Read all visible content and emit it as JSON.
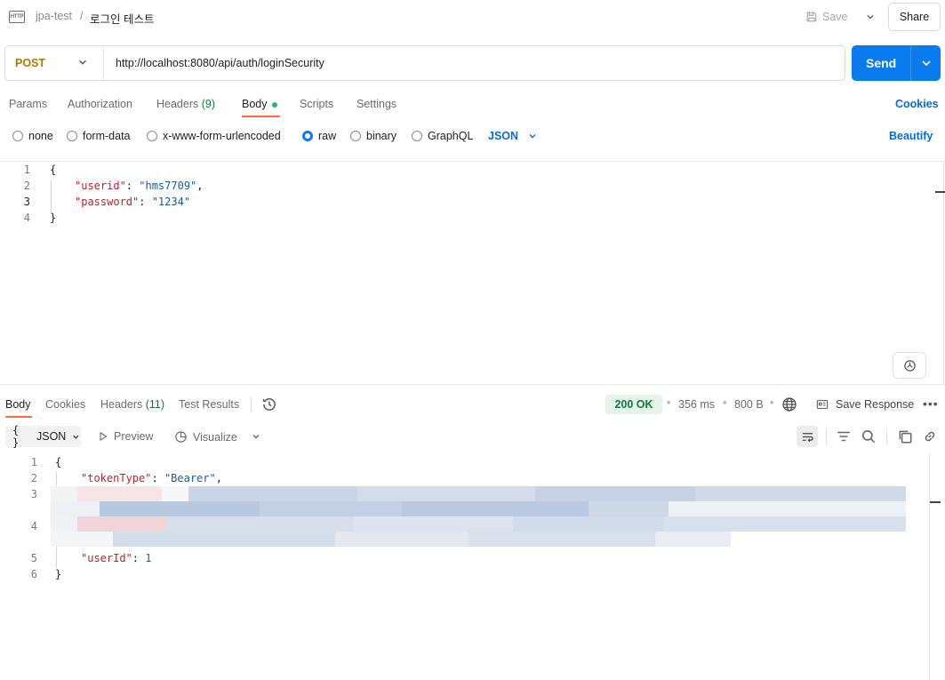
{
  "header": {
    "collection": "jpa-test",
    "separator": "/",
    "request_name": "로그인 테스트",
    "save_label": "Save",
    "share_label": "Share"
  },
  "request": {
    "method": "POST",
    "url": "http://localhost:8080/api/auth/loginSecurity",
    "send_label": "Send"
  },
  "request_tabs": {
    "params": "Params",
    "authorization": "Authorization",
    "headers": "Headers",
    "headers_count": "(9)",
    "body": "Body",
    "scripts": "Scripts",
    "settings": "Settings",
    "cookies": "Cookies"
  },
  "body_types": {
    "none": "none",
    "form_data": "form-data",
    "urlencoded": "x-www-form-urlencoded",
    "raw": "raw",
    "binary": "binary",
    "graphql": "GraphQL",
    "selected": "raw",
    "language": "JSON",
    "beautify": "Beautify"
  },
  "request_body": {
    "line_numbers": [
      "1",
      "2",
      "3",
      "4"
    ],
    "open_brace": "{",
    "close_brace": "}",
    "userid_key": "\"userid\"",
    "userid_value": "\"hms7709\"",
    "password_key": "\"password\"",
    "password_value": "\"1234\""
  },
  "response_tabs": {
    "body": "Body",
    "cookies": "Cookies",
    "headers": "Headers",
    "headers_count": "(11)",
    "test_results": "Test Results"
  },
  "response_meta": {
    "status": "200 OK",
    "time": "356 ms",
    "size": "800 B",
    "save_response": "Save Response"
  },
  "response_toolbar": {
    "format": "JSON",
    "preview": "Preview",
    "visualize": "Visualize"
  },
  "response_body": {
    "line_numbers": [
      "1",
      "2",
      "3",
      "4",
      "5",
      "6"
    ],
    "open_brace": "{",
    "close_brace": "}",
    "token_type_key": "\"tokenType\"",
    "token_type_value": "\"Bearer\"",
    "user_id_key": "\"userId\"",
    "user_id_value": "1"
  },
  "colors": {
    "accent": "#097bed",
    "method_post": "#ab7a00",
    "active_tab_underline": "#ff6c37",
    "status_ok": "#0f7b3e"
  }
}
